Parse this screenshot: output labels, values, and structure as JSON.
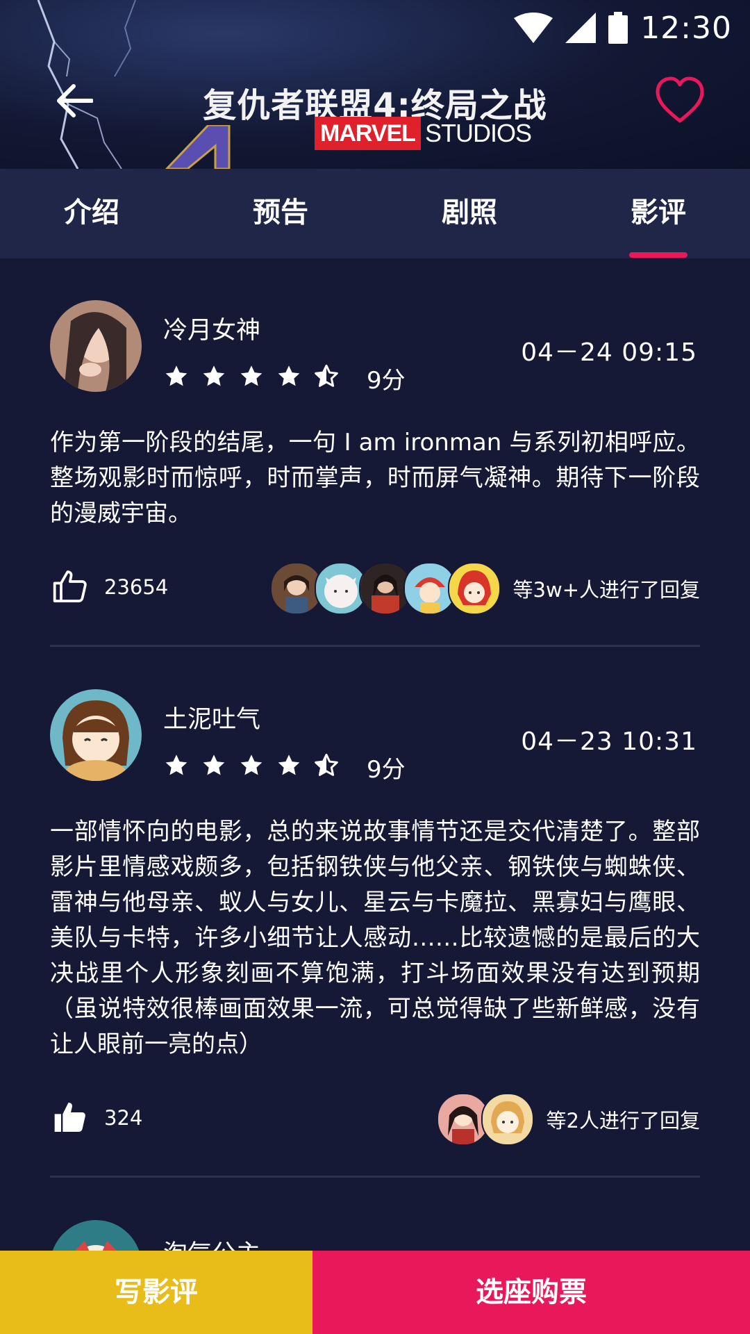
{
  "status_bar": {
    "time": "12:30"
  },
  "header": {
    "title": "复仇者联盟4:终局之战",
    "logo_left": "MARVEL",
    "logo_right": "STUDIOS"
  },
  "tabs": [
    {
      "label": "介绍"
    },
    {
      "label": "预告"
    },
    {
      "label": "剧照"
    },
    {
      "label": "影评",
      "active": true
    }
  ],
  "reviews": [
    {
      "username": "冷月女神",
      "rating_stars": 4.5,
      "score": "9分",
      "date": "04－24   09:15",
      "content": "作为第一阶段的结尾，一句 I am ironman 与系列初相呼应。整场观影时而惊呼，时而掌声，时而屏气凝神。期待下一阶段的漫威宇宙。",
      "likes": "23654",
      "liked": false,
      "reply_avatars": 5,
      "reply_text": "等3w+人进行了回复"
    },
    {
      "username": "土泥吐气",
      "rating_stars": 4.5,
      "score": "9分",
      "date": "04－23   10:31",
      "content": "一部情怀向的电影，总的来说故事情节还是交代清楚了。整部影片里情感戏颇多，包括钢铁侠与他父亲、钢铁侠与蜘蛛侠、雷神与他母亲、蚁人与女儿、星云与卡魔拉、黑寡妇与鹰眼、美队与卡特，许多小细节让人感动……比较遗憾的是最后的大决战里个人形象刻画不算饱满，打斗场面效果没有达到预期（虽说特效很棒画面效果一流，可总觉得缺了些新鲜感，没有让人眼前一亮的点）",
      "likes": "324",
      "liked": true,
      "reply_avatars": 2,
      "reply_text": "等2人进行了回复"
    },
    {
      "username": "淘气公主"
    }
  ],
  "bottom_bar": {
    "write_label": "写影评",
    "buy_label": "选座购票"
  },
  "colors": {
    "background": "#151935",
    "tab_bar": "#1f2647",
    "accent": "#e8185a",
    "write_button": "#e8bc19"
  }
}
